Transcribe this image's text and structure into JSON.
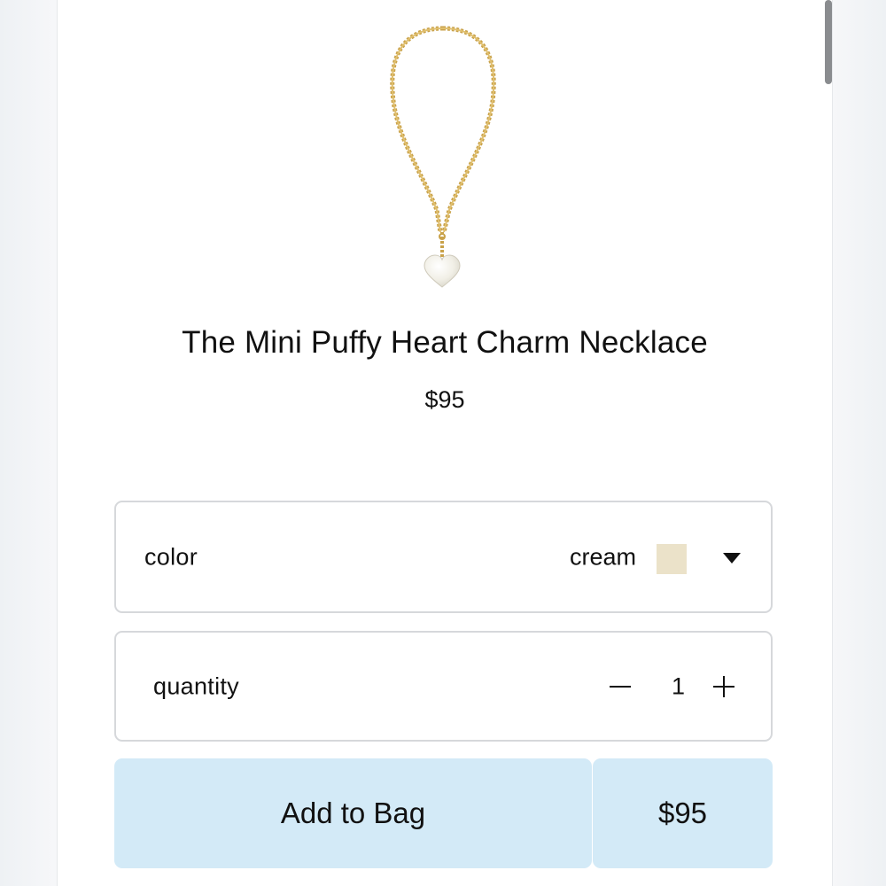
{
  "product": {
    "image_icon": "necklace-image",
    "title": "The Mini Puffy Heart Charm Necklace",
    "price": "$95"
  },
  "color_option": {
    "label": "color",
    "selected_value": "cream",
    "swatch_color": "#ebe2c9",
    "dropdown_icon": "caret-down-icon"
  },
  "quantity_option": {
    "label": "quantity",
    "value": "1",
    "decrement_icon": "minus-icon",
    "increment_icon": "plus-icon"
  },
  "add_to_bag": {
    "label": "Add to Bag",
    "price": "$95",
    "background": "#d3eaf7"
  }
}
